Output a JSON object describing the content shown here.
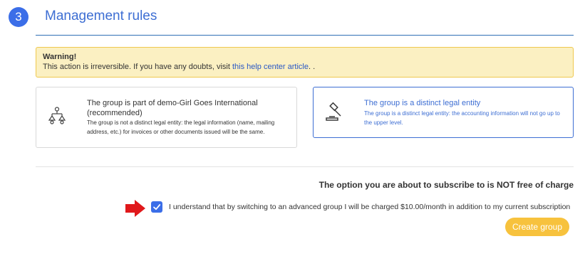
{
  "section": {
    "step_number": "3",
    "title": "Management rules"
  },
  "warning": {
    "title": "Warning!",
    "text_before": "This action is irreversible. If you have any doubts, visit ",
    "link_text": "this help center article",
    "text_after": ". ."
  },
  "options": [
    {
      "icon": "org-chart-icon",
      "title": "The group is part of demo-Girl Goes International (recommended)",
      "description": "The group is not a distinct legal entity: the legal information (name, mailing address, etc.) for invoices or other documents issued will be the same.",
      "selected": false
    },
    {
      "icon": "gavel-icon",
      "title": "The group is a distinct legal entity",
      "description": "The group is a distinct legal entity: the accounting information will not go up to the upper level.",
      "selected": true
    }
  ],
  "charge": {
    "heading": "The option you are about to subscribe to is NOT free of charge",
    "consent_label": "I understand that by switching to an advanced group I will be charged $10.00/month in addition to my current subscription",
    "consent_checked": true
  },
  "actions": {
    "create_label": "Create group"
  },
  "colors": {
    "accent": "#3b6ee8",
    "warning_bg": "#fbf0c2",
    "warning_border": "#efc84e",
    "button": "#f7c23d",
    "arrow": "#e0181b"
  }
}
